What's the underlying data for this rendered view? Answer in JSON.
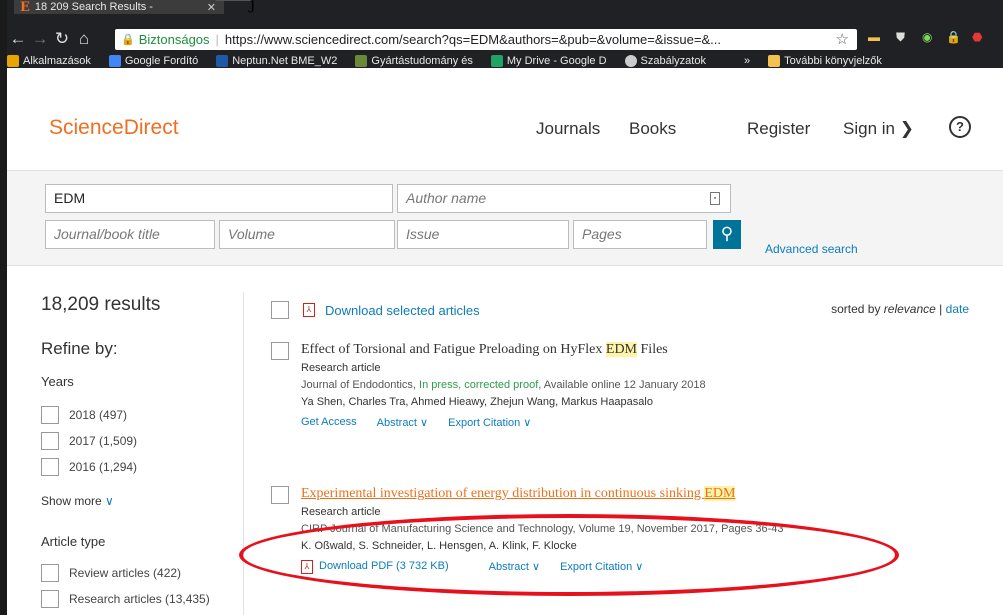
{
  "browser": {
    "tab_title": "18 209 Search Results -",
    "tab_favicon": "E",
    "overlay_char": "j",
    "secure_label": "Biztonságos",
    "url": "https://www.sciencedirect.com/search?qs=EDM&authors=&pub=&volume=&issue=&...",
    "bookmarks": [
      {
        "label": "Alkalmazások",
        "icon": "apps-icon",
        "color": "#e8a400"
      },
      {
        "label": "Google Fordító",
        "icon": "translate-icon",
        "color": "#4285f4"
      },
      {
        "label": "Neptun.Net BME_W2",
        "icon": "neptun-icon",
        "color": "#1e5aa8"
      },
      {
        "label": "Gyártástudomány és",
        "icon": "gy-icon",
        "color": "#6a8a3a"
      },
      {
        "label": "My Drive - Google D",
        "icon": "drive-icon",
        "color": "#1fa463"
      },
      {
        "label": "Szabályzatok",
        "icon": "gear-icon",
        "color": "#cccccc"
      }
    ],
    "more_bookmarks_label": "»",
    "other_bookmarks": "További könyvjelzők"
  },
  "site": {
    "logo": "ScienceDirect",
    "nav": {
      "journals": "Journals",
      "books": "Books",
      "register": "Register",
      "signin": "Sign in ❯",
      "help": "?"
    }
  },
  "search": {
    "query": "EDM",
    "author_placeholder": "Author name",
    "journal_placeholder": "Journal/book title",
    "volume_placeholder": "Volume",
    "issue_placeholder": "Issue",
    "pages_placeholder": "Pages",
    "advanced": "Advanced search"
  },
  "results": {
    "count": "18,209 results",
    "refine": "Refine by:",
    "download_selected": "Download selected articles",
    "sorted_prefix": "sorted by",
    "sorted_relevance": "relevance",
    "sorted_sep": "|",
    "sorted_date": "date"
  },
  "facets": {
    "years_title": "Years",
    "years": [
      "2018 (497)",
      "2017 (1,509)",
      "2016 (1,294)"
    ],
    "show_more": "Show more",
    "type_title": "Article type",
    "types": [
      "Review articles (422)",
      "Research articles (13,435)"
    ]
  },
  "items": [
    {
      "title_pre": "Effect of Torsional and Fatigue Preloading on HyFlex ",
      "title_hl": "EDM",
      "title_post": " Files",
      "type": "Research article",
      "source_pre": "Journal of Endodontics, ",
      "source_green": "In press, corrected proof",
      "source_post": ", Available online 12 January 2018",
      "authors": "Ya Shen, Charles Tra, Ahmed Hieawy, Zhejun Wang, Markus Haapasalo",
      "actions": [
        "Get Access",
        "Abstract ∨",
        "Export Citation ∨"
      ]
    },
    {
      "title_pre": "Experimental investigation of energy distribution in continuous sinking ",
      "title_hl": "EDM",
      "title_post": "",
      "type": "Research article",
      "source_pre": "CIRP Journal of Manufacturing Science and Technology, Volume 19, November 2017, Pages 36-43",
      "authors": "K. Oßwald, S. Schneider, L. Hensgen, A. Klink, F. Klocke",
      "actions": [
        "Download PDF (3 732 KB)",
        "Abstract ∨",
        "Export Citation ∨"
      ]
    }
  ],
  "colors": {
    "brand": "#f36d21",
    "link": "#0c7dbb",
    "annotation": "#e8101a"
  }
}
